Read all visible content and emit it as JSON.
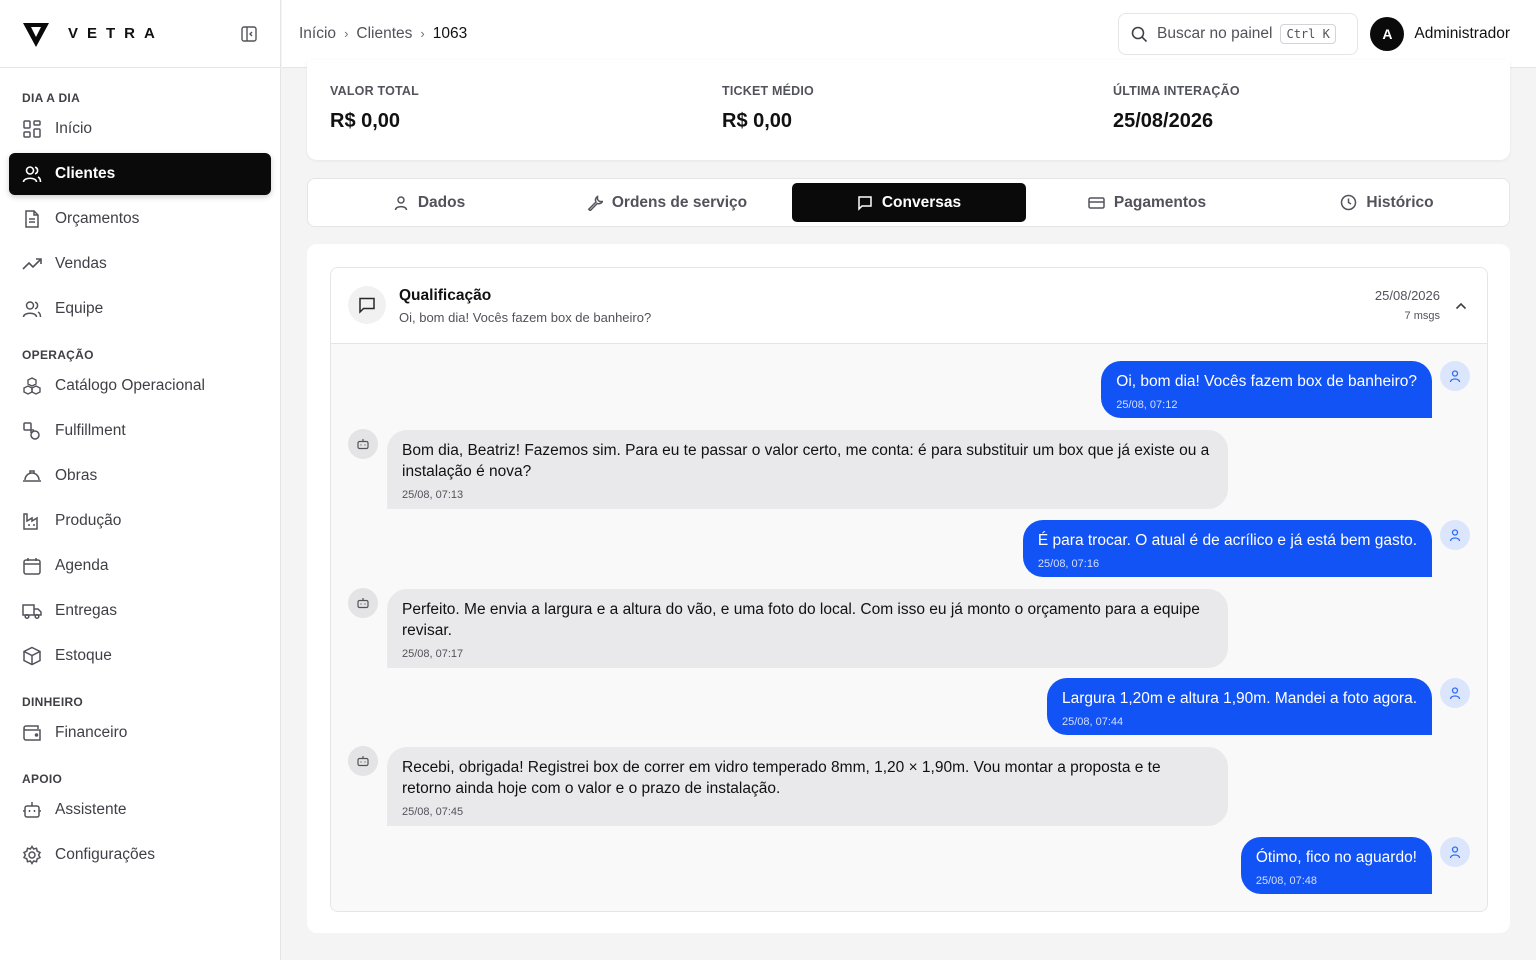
{
  "brand": {
    "name": "VETRA"
  },
  "sidebar": {
    "sections": [
      {
        "title": "DIA A DIA",
        "items": [
          {
            "label": "Início",
            "icon": "grid-icon"
          },
          {
            "label": "Clientes",
            "icon": "users-icon",
            "active": true
          },
          {
            "label": "Orçamentos",
            "icon": "document-icon"
          },
          {
            "label": "Vendas",
            "icon": "trending-up-icon"
          },
          {
            "label": "Equipe",
            "icon": "users-icon"
          }
        ]
      },
      {
        "title": "OPERAÇÃO",
        "items": [
          {
            "label": "Catálogo Operacional",
            "icon": "boxes-icon"
          },
          {
            "label": "Fulfillment",
            "icon": "shapes-icon"
          },
          {
            "label": "Obras",
            "icon": "hard-hat-icon"
          },
          {
            "label": "Produção",
            "icon": "factory-icon"
          },
          {
            "label": "Agenda",
            "icon": "calendar-icon"
          },
          {
            "label": "Entregas",
            "icon": "truck-icon"
          },
          {
            "label": "Estoque",
            "icon": "package-icon"
          }
        ]
      },
      {
        "title": "DINHEIRO",
        "items": [
          {
            "label": "Financeiro",
            "icon": "wallet-icon"
          }
        ]
      },
      {
        "title": "APOIO",
        "items": [
          {
            "label": "Assistente",
            "icon": "bot-icon"
          },
          {
            "label": "Configurações",
            "icon": "gear-icon"
          }
        ]
      }
    ]
  },
  "breadcrumb": {
    "home": "Início",
    "section": "Clientes",
    "current": "1063"
  },
  "search": {
    "placeholder": "Buscar no painel",
    "shortcut": "Ctrl K"
  },
  "user": {
    "initial": "A",
    "name": "Administrador"
  },
  "stats": [
    {
      "label": "VALOR TOTAL",
      "value": "R$ 0,00"
    },
    {
      "label": "TICKET MÉDIO",
      "value": "R$ 0,00"
    },
    {
      "label": "ÚLTIMA INTERAÇÃO",
      "value": "25/08/2026"
    }
  ],
  "tabs": [
    {
      "label": "Dados",
      "icon": "user-icon"
    },
    {
      "label": "Ordens de serviço",
      "icon": "wrench-icon"
    },
    {
      "label": "Conversas",
      "icon": "message-icon",
      "active": true
    },
    {
      "label": "Pagamentos",
      "icon": "credit-card-icon"
    },
    {
      "label": "Histórico",
      "icon": "clock-icon"
    }
  ],
  "conversation": {
    "title": "Qualificação",
    "preview": "Oi, bom dia! Vocês fazem box de banheiro?",
    "date": "25/08/2026",
    "count": "7 msgs",
    "messages": [
      {
        "from": "client",
        "text": "Oi, bom dia! Vocês fazem box de banheiro?",
        "time": "25/08, 07:12"
      },
      {
        "from": "bot",
        "text": "Bom dia, Beatriz! Fazemos sim. Para eu te passar o valor certo, me conta: é para substituir um box que já existe ou a instalação é nova?",
        "time": "25/08, 07:13"
      },
      {
        "from": "client",
        "text": "É para trocar. O atual é de acrílico e já está bem gasto.",
        "time": "25/08, 07:16"
      },
      {
        "from": "bot",
        "text": "Perfeito. Me envia a largura e a altura do vão, e uma foto do local. Com isso eu já monto o orçamento para a equipe revisar.",
        "time": "25/08, 07:17"
      },
      {
        "from": "client",
        "text": "Largura 1,20m e altura 1,90m. Mandei a foto agora.",
        "time": "25/08, 07:44"
      },
      {
        "from": "bot",
        "text": "Recebi, obrigada! Registrei box de correr em vidro temperado 8mm, 1,20 × 1,90m. Vou montar a proposta e te retorno ainda hoje com o valor e o prazo de instalação.",
        "time": "25/08, 07:45"
      },
      {
        "from": "client",
        "text": "Ótimo, fico no aguardo!",
        "time": "25/08, 07:48"
      }
    ]
  },
  "colors": {
    "accent": "#1253f5",
    "active_nav": "#0a0a0a",
    "bot_bubble": "#e9e9eb"
  }
}
